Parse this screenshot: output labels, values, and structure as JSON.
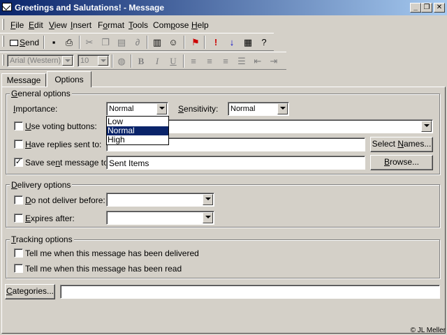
{
  "window": {
    "title": "Greetings and Salutations! - Message",
    "controls": [
      "_",
      "❐",
      "✕"
    ]
  },
  "menubar": {
    "items": [
      {
        "pre": "",
        "key": "F",
        "post": "ile"
      },
      {
        "pre": "",
        "key": "E",
        "post": "dit"
      },
      {
        "pre": "",
        "key": "V",
        "post": "iew"
      },
      {
        "pre": "",
        "key": "I",
        "post": "nsert"
      },
      {
        "pre": "F",
        "key": "o",
        "post": "rmat"
      },
      {
        "pre": "",
        "key": "T",
        "post": "ools"
      },
      {
        "pre": "Com",
        "key": "p",
        "post": "ose"
      },
      {
        "pre": "",
        "key": "H",
        "post": "elp"
      }
    ]
  },
  "toolbar": {
    "send_pre": "",
    "send_key": "S",
    "send_post": "end",
    "font_value": "Arial (Western)",
    "size_value": "10"
  },
  "tabs": {
    "message": "Message",
    "options": "Options"
  },
  "general": {
    "title_pre": "",
    "title_key": "G",
    "title_post": "eneral options",
    "importance_pre": "",
    "importance_key": "I",
    "importance_post": "mportance:",
    "importance_value": "Normal",
    "importance_options": [
      "Low",
      "Normal",
      "High"
    ],
    "importance_selected_index": 1,
    "sensitivity_pre": "",
    "sensitivity_key": "S",
    "sensitivity_post": "ensitivity:",
    "sensitivity_value": "Normal",
    "voting_pre": "",
    "voting_key": "U",
    "voting_post": "se voting buttons:",
    "voting_checked": false,
    "replies_pre": "",
    "replies_key": "H",
    "replies_post": "ave replies sent to:",
    "replies_checked": false,
    "replies_value": "",
    "select_names_pre": "Select ",
    "select_names_key": "N",
    "select_names_post": "ames...",
    "save_sent_pre": "Save se",
    "save_sent_key": "n",
    "save_sent_post": "t message to:",
    "save_sent_checked": true,
    "save_sent_value": "Sent Items",
    "browse_pre": "",
    "browse_key": "B",
    "browse_post": "rowse..."
  },
  "delivery": {
    "title_pre": "",
    "title_key": "D",
    "title_post": "elivery options",
    "not_before_pre": "",
    "not_before_key": "D",
    "not_before_post": "o not deliver before:",
    "not_before_checked": false,
    "not_before_value": "",
    "expires_pre": "",
    "expires_key": "E",
    "expires_post": "xpires after:",
    "expires_checked": false,
    "expires_value": ""
  },
  "tracking": {
    "title_pre": "",
    "title_key": "T",
    "title_post": "racking options",
    "delivered_label": "Tell me when this message has been delivered",
    "delivered_checked": false,
    "read_label": "Tell me when this message has been read",
    "read_checked": false
  },
  "categories": {
    "button_pre": "",
    "button_key": "C",
    "button_post": "ategories...",
    "value": ""
  },
  "copyright": "© JL Meller",
  "colors": {
    "titlebar_start": "#0a246a",
    "titlebar_end": "#a6caf0",
    "face": "#d4d0c8",
    "selection": "#0a246a",
    "flag_red": "#cc0000",
    "arrow_blue": "#0000cc"
  }
}
